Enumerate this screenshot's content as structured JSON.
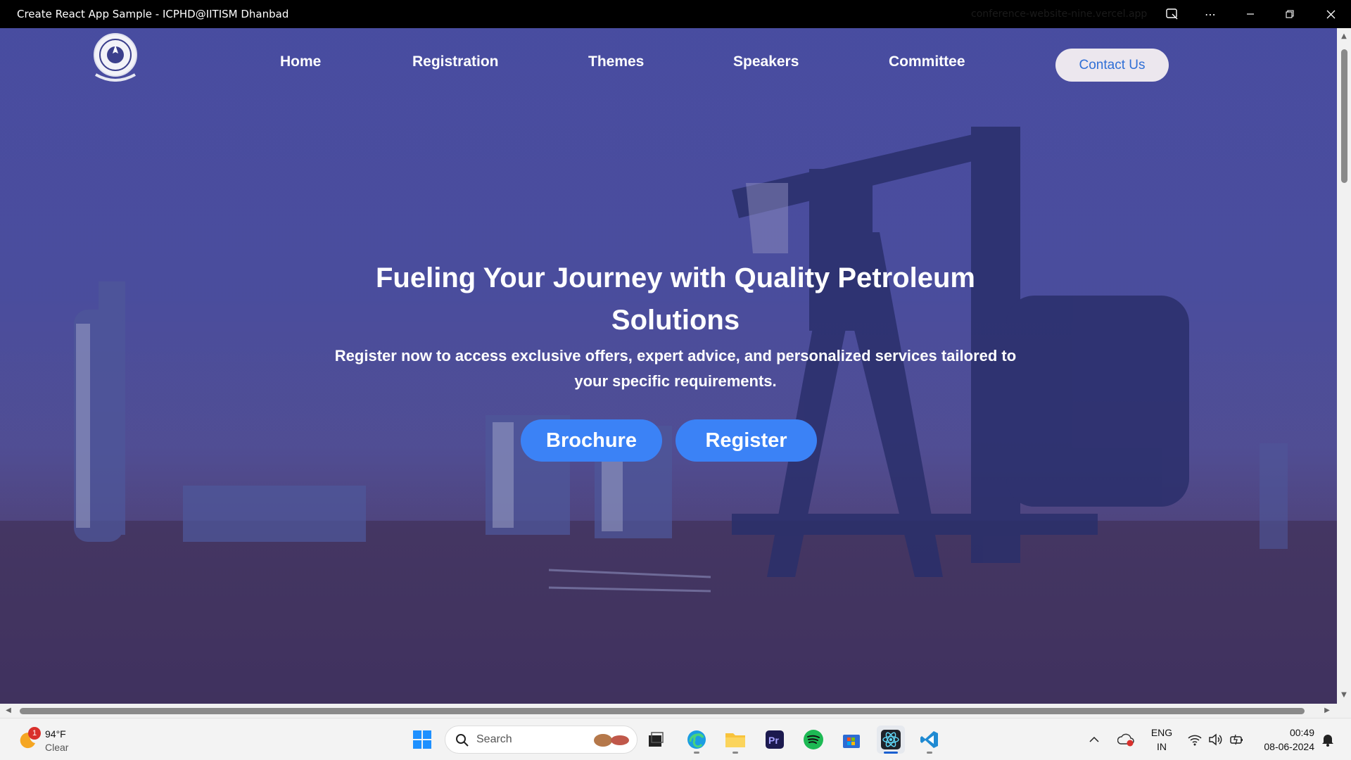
{
  "window": {
    "title": "Create React App Sample - ICPHD@IITISM Dhanbad",
    "url": "conference-website-nine.vercel.app",
    "controls": [
      "reader-icon",
      "more-icon",
      "minimize-icon",
      "restore-icon",
      "close-icon"
    ]
  },
  "nav": {
    "logo": "iitism-logo",
    "links": [
      {
        "label": "Home"
      },
      {
        "label": "Registration"
      },
      {
        "label": "Themes"
      },
      {
        "label": "Speakers"
      },
      {
        "label": "Committee"
      }
    ],
    "contact_label": "Contact Us"
  },
  "hero": {
    "title": "Fueling Your Journey with Quality Petroleum Solutions",
    "subtitle": "Register now to access exclusive offers, expert advice, and personalized services tailored to your specific requirements.",
    "buttons": {
      "brochure": "Brochure",
      "register": "Register"
    }
  },
  "colors": {
    "overlay": "#343287",
    "button": "#3b82f6",
    "contact_bg": "#ece7ee",
    "contact_text": "#2f6fd6"
  },
  "taskbar": {
    "weather": {
      "badge": "1",
      "temp": "94°F",
      "condition": "Clear"
    },
    "search_label": "Search",
    "apps": [
      "windows-start-icon",
      "search-icon",
      "task-view-icon",
      "edge-icon",
      "file-explorer-icon",
      "premiere-pro-icon",
      "spotify-icon",
      "microsoft-store-icon",
      "react-app-icon",
      "vscode-icon"
    ],
    "tray": {
      "lang1": "ENG",
      "lang2": "IN",
      "time": "00:49",
      "date": "08-06-2024"
    }
  }
}
